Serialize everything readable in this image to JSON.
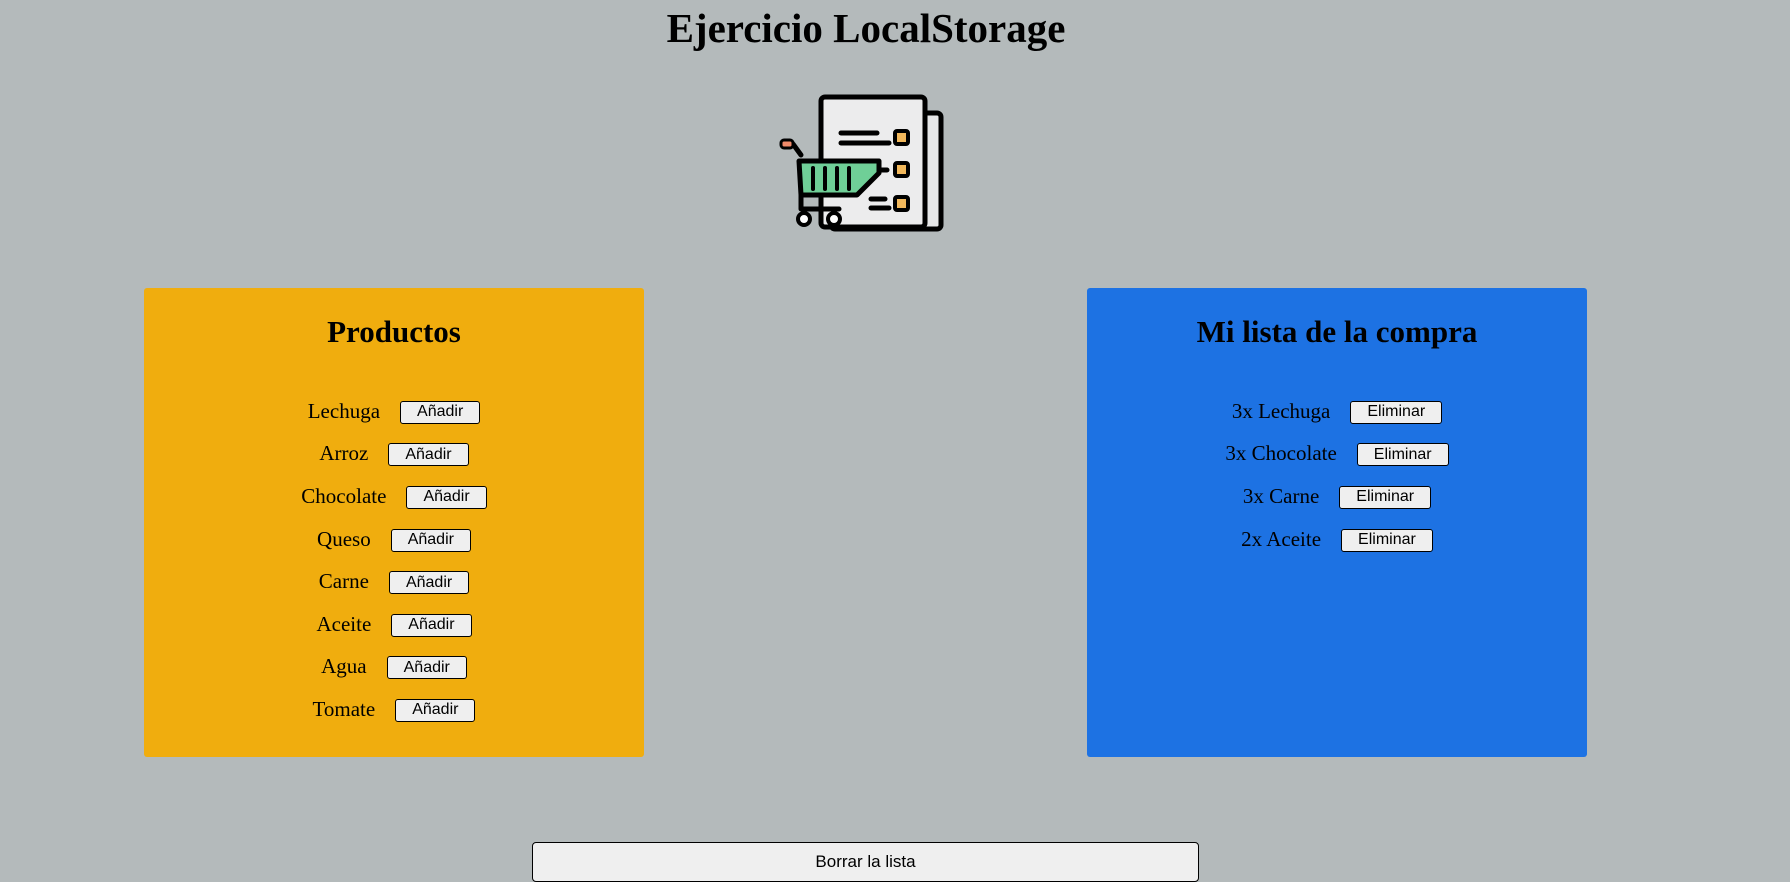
{
  "header": {
    "title": "Ejercicio LocalStorage"
  },
  "logo": {
    "icon": "shopping-list-cart-icon",
    "colors": {
      "paper": "#e8e9ea",
      "cart": "#6fcf97",
      "checkbox": "#f2b85c",
      "handle": "#f08a6a",
      "outline": "#000000"
    }
  },
  "products": {
    "title": "Productos",
    "background": "#f0ad0e",
    "button_label": "Añadir",
    "items": [
      {
        "name": "Lechuga"
      },
      {
        "name": "Arroz"
      },
      {
        "name": "Chocolate"
      },
      {
        "name": "Queso"
      },
      {
        "name": "Carne"
      },
      {
        "name": "Aceite"
      },
      {
        "name": "Agua"
      },
      {
        "name": "Tomate"
      }
    ]
  },
  "cart": {
    "title": "Mi lista de la compra",
    "background": "#1d72e3",
    "button_label": "Eliminar",
    "items": [
      {
        "label": "3x Lechuga"
      },
      {
        "label": "3x Chocolate"
      },
      {
        "label": "3x Carne"
      },
      {
        "label": "2x Aceite"
      }
    ]
  },
  "footer": {
    "clear_label": "Borrar la lista"
  }
}
